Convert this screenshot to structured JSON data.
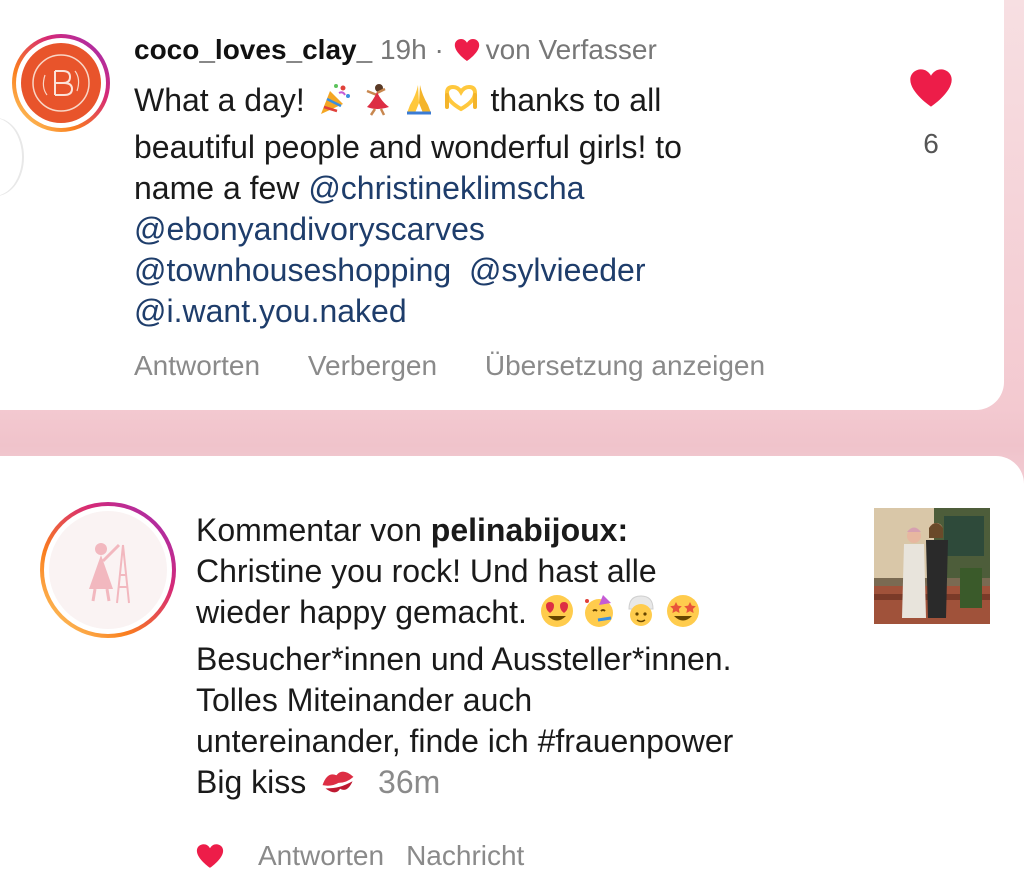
{
  "comment": {
    "username": "coco_loves_clay_",
    "time": "19h",
    "separator": "·",
    "liked_by_author": "von Verfasser",
    "text_line1_start": "What a day!",
    "text_line1_end": "thanks to all",
    "text_line2": "beautiful people and wonderful girls! to",
    "text_line3_start": "name a few",
    "mentions": [
      "@christineklimscha",
      "@ebonyandivoryscarves",
      "@townhouseshopping",
      "@sylvieeder",
      "@i.want.you.naked"
    ],
    "emojis": [
      "party-popper",
      "dancer",
      "folded-hands",
      "heart-hands"
    ],
    "like_count": "6",
    "actions": [
      "Antworten",
      "Verbergen",
      "Übersetzung anzeigen"
    ]
  },
  "reply": {
    "prefix": "Kommentar von",
    "author": "pelinabijoux:",
    "line2": "Christine you rock! Und hast alle",
    "line3": "wieder happy gemacht.",
    "line4": "Besucher*innen und Aussteller*innen.",
    "line5": "Tolles Miteinander auch",
    "line6": "untereinander, finde ich #frauenpower",
    "line7": "Big kiss",
    "time": "36m",
    "emojis": [
      "heart-eyes",
      "party-face",
      "person-turban",
      "star-struck",
      "kiss-mark"
    ],
    "actions": [
      "Antworten",
      "Nachricht"
    ]
  },
  "colors": {
    "heart": "#ed1d49",
    "mention": "#1e3d6b",
    "meta": "#8a8a8a",
    "avatar_orange": "#e8542b"
  }
}
